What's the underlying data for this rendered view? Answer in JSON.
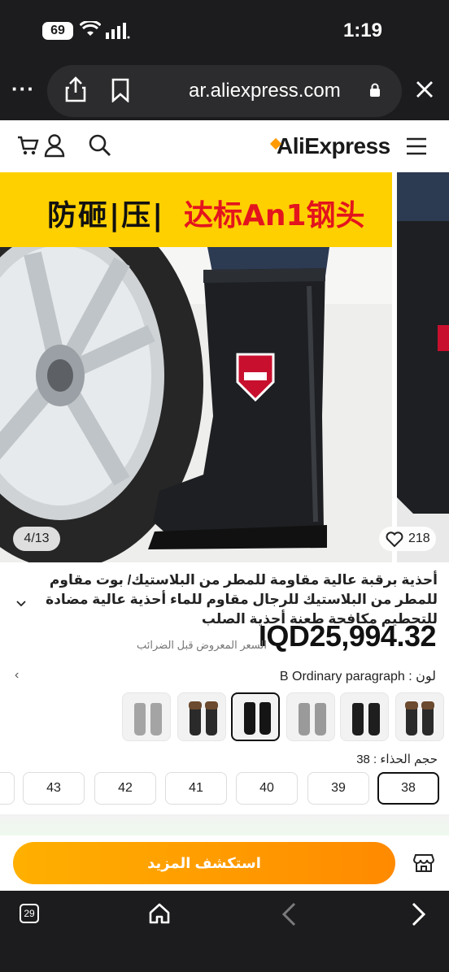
{
  "status_bar": {
    "battery": "69",
    "time": "1:19"
  },
  "url_bar": {
    "url": "ar.aliexpress.com"
  },
  "site_header": {
    "logo": "AliExpress"
  },
  "gallery": {
    "banner_left": "防砸|压|",
    "banner_right": "达标An1钢头",
    "counter": "4/13",
    "wishlist_count": "218"
  },
  "product": {
    "title": "أحذية برقبة عالية مقاومة للمطر من البلاستيك/ بوت مقاوم للمطر من البلاستيك للرجال مقاوم للماء أحذية عالية مضادة للتحطيم مكافحة طعنة أحذية الصلب",
    "price": "IQD25,994.32",
    "price_note": "السعر المعروض قبل الضرائب",
    "color_label": "لون : B Ordinary paragraph",
    "size_label": "حجم الحذاء : 38",
    "sizes": [
      "38",
      "39",
      "40",
      "41",
      "42",
      "43"
    ],
    "selected_size": "38"
  },
  "actions": {
    "explore_more": "استكشف المزيد"
  },
  "browser_bar": {
    "tab_count": "29"
  },
  "colors": {
    "accent": "#ff9a00",
    "banner_yellow": "#ffd000",
    "banner_red": "#e3141e",
    "cta_orange": "#ff9500"
  }
}
